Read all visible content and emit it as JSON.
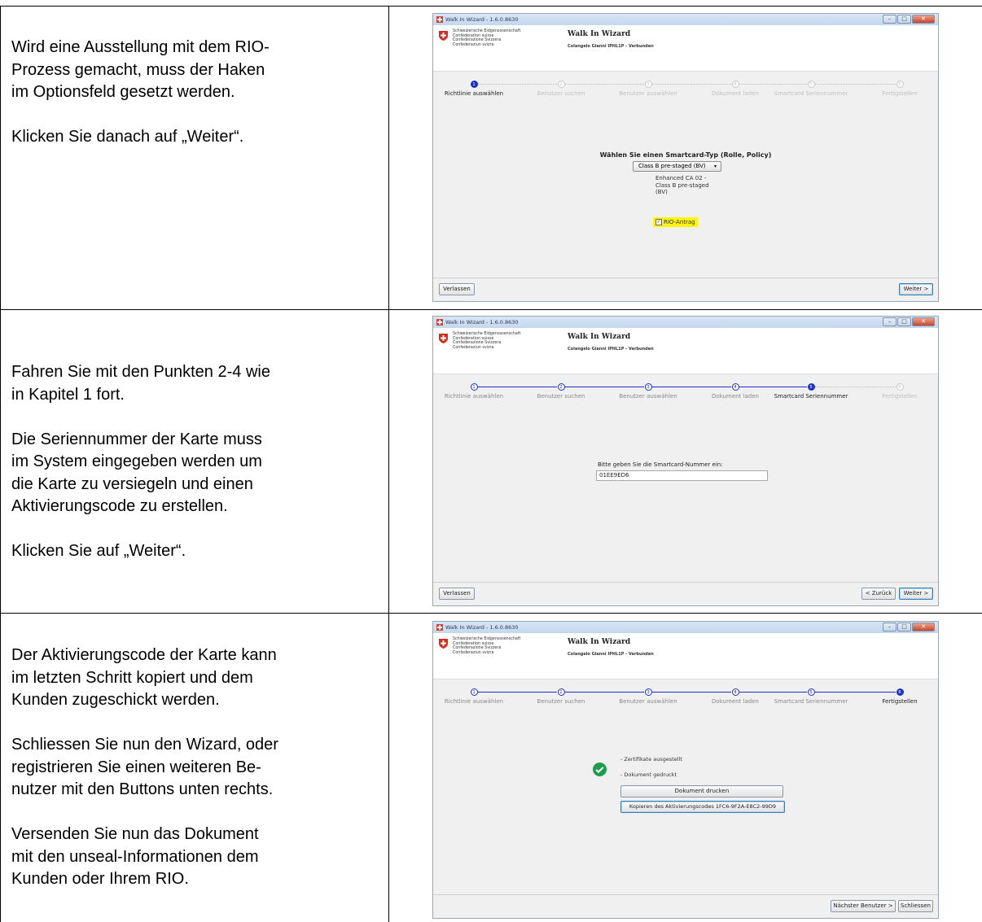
{
  "rows": [
    {
      "paragraphs": [
        "Wird eine Ausstellung mit dem RIO-\nProzess gemacht, muss der Haken\nim Optionsfeld gesetzt werden.",
        "Klicken Sie danach auf „Weiter“."
      ],
      "screenshot": {
        "window_title": "Walk In Wizard - 1.6.0.8630",
        "agency": "Schweizerische Eidgenossenschaft\nConfédération suisse\nConfederazione Svizzera\nConfederaziun svizra",
        "wizard_title": "Walk In Wizard",
        "subtitle": "Colangelo Gianni IPHL1P - Verbunden",
        "steps": [
          "Richtlinie auswählen",
          "Benutzer suchen",
          "Benutzer auswählen",
          "Dokument laden",
          "Smartcard Seriennummer",
          "Fertigstellen"
        ],
        "step_numbers": [
          "1",
          "2",
          "3",
          "4",
          "5",
          "6"
        ],
        "prompt": "Wählen Sie einen Smartcard-Typ (Rolle, Policy)",
        "select_value": "Class B pre-staged (BV)",
        "description": "Enhanced CA 02 -\nClass B pre-staged\n(BV)",
        "checkbox_label": "RIO-Antrag",
        "left_button": "Verlassen",
        "next_button": "Weiter >"
      }
    },
    {
      "paragraphs": [
        "Fahren Sie mit den Punkten 2-4 wie\nin Kapitel 1 fort.",
        "Die Seriennummer der Karte muss\nim System eingegeben werden um\ndie Karte zu versiegeln und einen\nAktivierungscode zu erstellen.",
        "Klicken Sie auf „Weiter“."
      ],
      "screenshot": {
        "window_title": "Walk In Wizard - 1.6.0.8630",
        "agency": "Schweizerische Eidgenossenschaft\nConfédération suisse\nConfederazione Svizzera\nConfederaziun svizra",
        "wizard_title": "Walk In Wizard",
        "subtitle": "Colangelo Gianni IPHL1P - Verbunden",
        "steps": [
          "Richtlinie auswählen",
          "Benutzer suchen",
          "Benutzer auswählen",
          "Dokument laden",
          "Smartcard Seriennummer",
          "Fertigstellen"
        ],
        "step_numbers": [
          "1",
          "2",
          "3",
          "4",
          "5",
          "6"
        ],
        "prompt": "Bitte geben Sie die Smartcard-Nummer ein:",
        "input_value": "01EE9ED6",
        "left_button": "Verlassen",
        "back_button": "< Zurück",
        "next_button": "Weiter >"
      }
    },
    {
      "paragraphs": [
        "Der Aktivierungscode der Karte kann\nim letzten Schritt kopiert und dem\nKunden zugeschickt werden.",
        "Schliessen Sie nun den Wizard, oder\nregistrieren Sie einen weiteren Be-\nnutzer mit den Buttons unten rechts.",
        "Versenden Sie nun das Dokument\nmit den unseal-Informationen dem\nKunden oder Ihrem RIO."
      ],
      "screenshot": {
        "window_title": "Walk In Wizard - 1.6.0.8630",
        "agency": "Schweizerische Eidgenossenschaft\nConfédération suisse\nConfederazione Svizzera\nConfederaziun svizra",
        "wizard_title": "Walk In Wizard",
        "subtitle": "Colangelo Gianni IPHL1P - Verbunden",
        "steps": [
          "Richtlinie auswählen",
          "Benutzer suchen",
          "Benutzer auswählen",
          "Dokument laden",
          "Smartcard Seriennummer",
          "Fertigstellen"
        ],
        "step_numbers": [
          "1",
          "2",
          "3",
          "4",
          "5",
          "6"
        ],
        "status_1": "- Zertifikate ausgestellt",
        "status_2": "- Dokument gedruckt",
        "print_button": "Dokument drucken",
        "copy_button": "Kopieren des Aktivierungscodes 1FC6-9F2A-E8C2-99D9",
        "next_user_button": "Nächster Benutzer >",
        "close_button": "Schliessen"
      }
    }
  ]
}
